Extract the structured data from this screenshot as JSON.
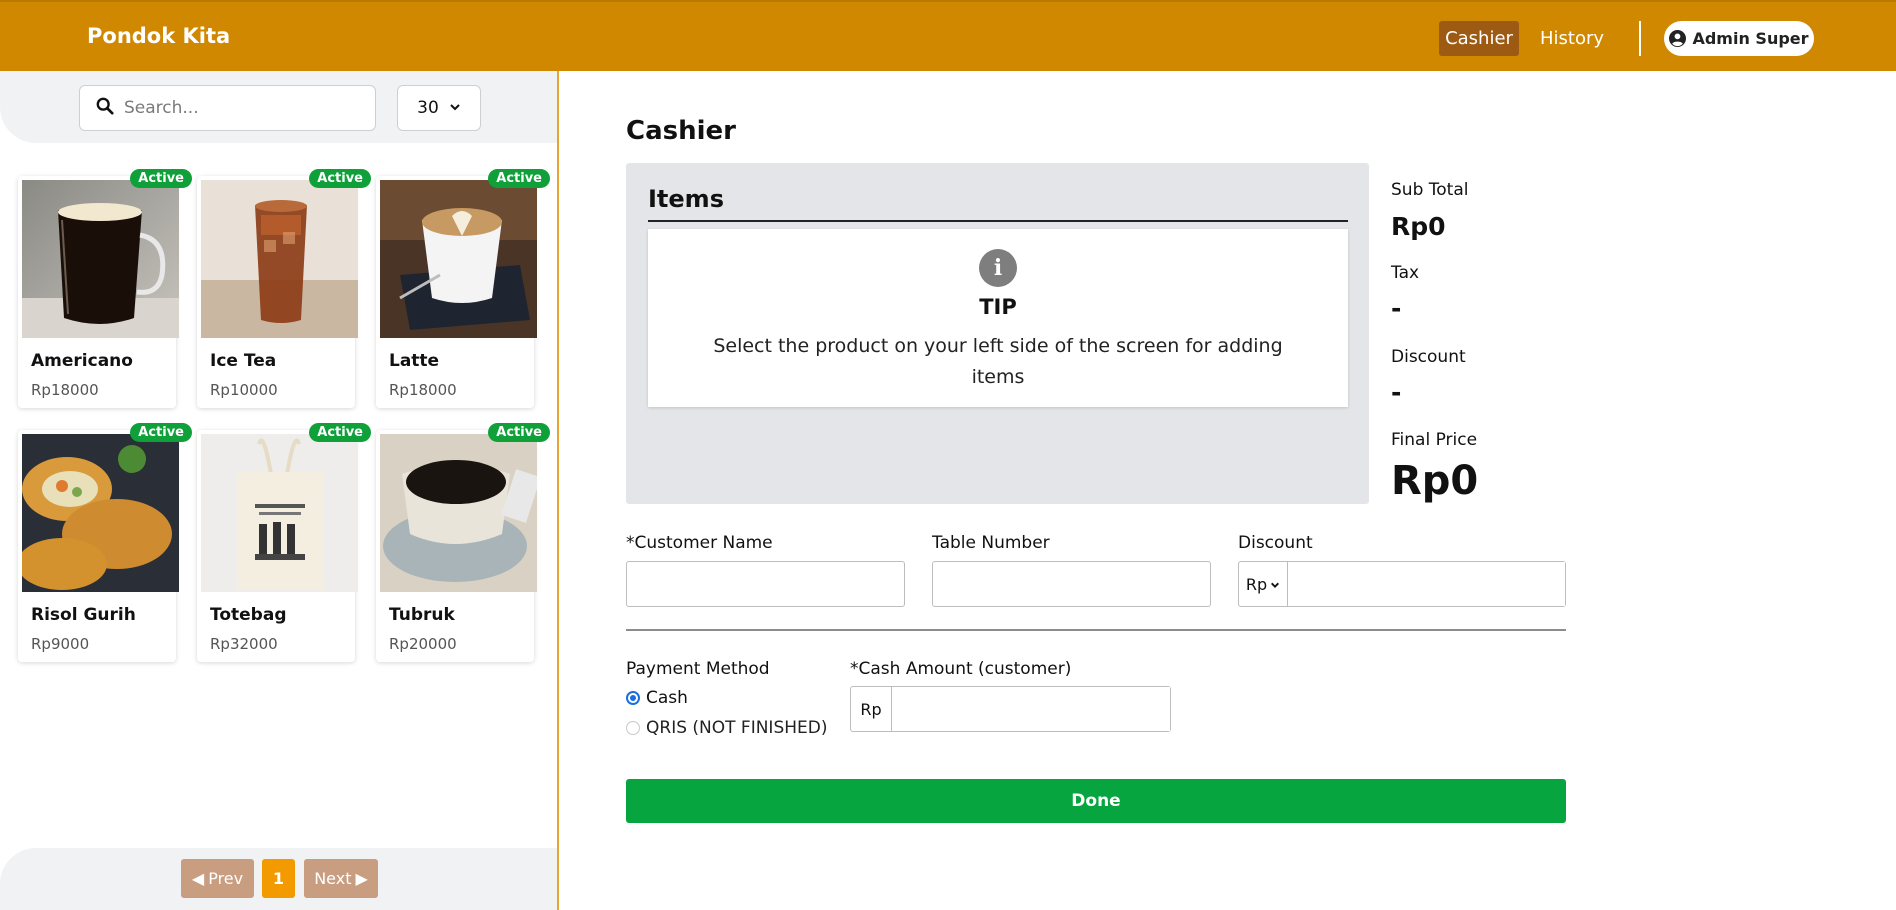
{
  "app": {
    "brand": "Pondok Kita"
  },
  "nav": {
    "cashier": "Cashier",
    "history": "History",
    "user": "Admin Super",
    "accent": "#CF8800"
  },
  "left": {
    "search": {
      "placeholder": "Search...",
      "value": ""
    },
    "per_page": "30",
    "products": [
      {
        "name": "Americano",
        "price": "Rp18000",
        "status": "Active",
        "icon": "coffee-glass-image"
      },
      {
        "name": "Ice Tea",
        "price": "Rp10000",
        "status": "Active",
        "icon": "iced-tea-image"
      },
      {
        "name": "Latte",
        "price": "Rp18000",
        "status": "Active",
        "icon": "latte-cup-image"
      },
      {
        "name": "Risol Gurih",
        "price": "Rp9000",
        "status": "Active",
        "icon": "risoles-image"
      },
      {
        "name": "Totebag",
        "price": "Rp32000",
        "status": "Active",
        "icon": "totebag-image"
      },
      {
        "name": "Tubruk",
        "price": "Rp20000",
        "status": "Active",
        "icon": "black-coffee-cup-image"
      }
    ],
    "pagination": {
      "prev": "Prev",
      "page": "1",
      "next": "Next"
    }
  },
  "main": {
    "title": "Cashier",
    "items": {
      "heading": "Items",
      "tip_title": "TIP",
      "tip_text": "Select the product on your left side of the screen for adding items"
    },
    "summary": {
      "subtotal_label": "Sub Total",
      "subtotal_value": "Rp0",
      "tax_label": "Tax",
      "tax_value": "-",
      "discount_label": "Discount",
      "discount_value": "-",
      "final_label": "Final Price",
      "final_value": "Rp0"
    },
    "form": {
      "customer_label": "*Customer Name",
      "customer_value": "",
      "table_label": "Table Number",
      "table_value": "",
      "discount_label": "Discount",
      "discount_unit": "Rp",
      "discount_value": "",
      "payment_label": "Payment Method",
      "payment_options": [
        {
          "label": "Cash",
          "checked": true
        },
        {
          "label": "QRIS (NOT FINISHED)",
          "checked": false
        }
      ],
      "cash_label": "*Cash Amount (customer)",
      "cash_prefix": "Rp",
      "cash_value": "",
      "done": "Done"
    },
    "colors": {
      "done": "#07A53F",
      "active_badge": "#0FA03A",
      "page_current": "#F39A00"
    }
  }
}
